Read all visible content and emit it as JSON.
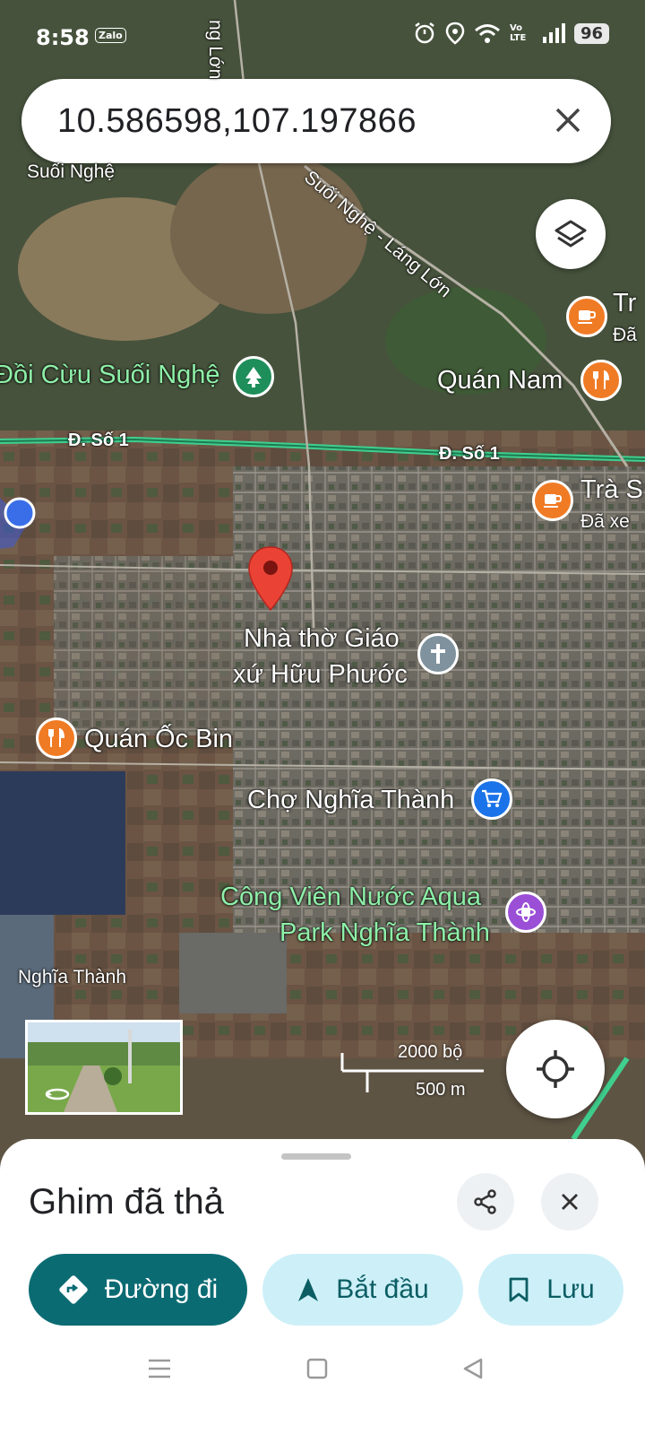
{
  "status_bar": {
    "time": "8:58",
    "zalo": "Zalo",
    "battery": "96",
    "network": "Vo LTE"
  },
  "search": {
    "query": "10.586598,107.197866"
  },
  "map": {
    "labels": {
      "suoi_nghe": "Suối Nghệ",
      "suoi_nghe_lang_lon": "Suối Nghệ - Láng Lớn",
      "top_road": "ng Lớn",
      "doi_cuu": "Đồi Cừu Suối Nghệ",
      "quan_nam": "Quán Nam",
      "road_d_so_1_left": "Đ. Số 1",
      "road_d_so_1_right": "Đ. Số 1",
      "tra_s": "Trà S",
      "tra_s_sub": "Đã xe",
      "tr_top": "Tr",
      "tr_top_sub": "Đã",
      "church": "Nhà thờ Giáo xứ Hữu Phước",
      "church_line1": "Nhà thờ Giáo",
      "church_line2": "xứ Hữu Phước",
      "quan_oc_bin": "Quán Ốc Bin",
      "cho_nghia_thanh": "Chợ Nghĩa Thành",
      "cong_vien_line1": "Công Viên Nước Aqua",
      "cong_vien_line2": "Park Nghĩa Thành",
      "nghia_thanh": "Nghĩa Thành"
    },
    "scale": {
      "imperial": "2000 bộ",
      "metric": "500 m"
    }
  },
  "sheet": {
    "title": "Ghim đã thả",
    "directions_label": "Đường đi",
    "start_label": "Bắt đầu",
    "save_label": "Lưu"
  },
  "colors": {
    "primary": "#0b6b73",
    "secondary_bg": "#cdf0f8",
    "pin": "#ea4335",
    "road": "#3fcf8e"
  }
}
